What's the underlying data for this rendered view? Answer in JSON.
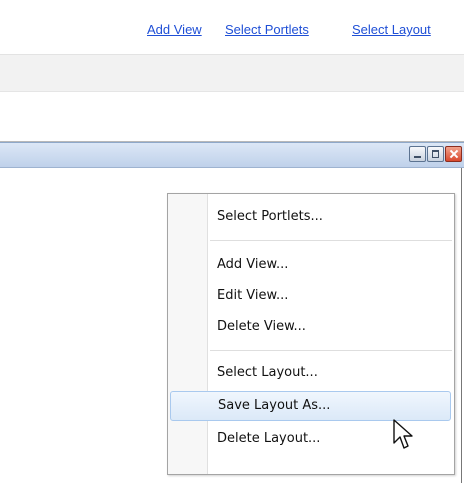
{
  "top_links": {
    "add_view": "Add View",
    "select_portlets": "Select Portlets",
    "select_layout": "Select Layout"
  },
  "window_controls": {
    "minimize": "minimize-icon",
    "maximize": "maximize-icon",
    "close": "close-icon"
  },
  "context_menu": {
    "items": [
      {
        "label": "Select Portlets..."
      },
      {
        "label": "Add View..."
      },
      {
        "label": "Edit View..."
      },
      {
        "label": "Delete View..."
      },
      {
        "label": "Select Layout..."
      },
      {
        "label": "Save Layout As...",
        "highlighted": true
      },
      {
        "label": "Delete Layout..."
      }
    ]
  },
  "colors": {
    "link": "#1f4fd6",
    "menu_highlight_border": "#a9c9ee",
    "menu_highlight_fill": "#dbe9f8",
    "titlebar": "#c7d8ef"
  },
  "cursor": "pointer-arrow-cursor"
}
